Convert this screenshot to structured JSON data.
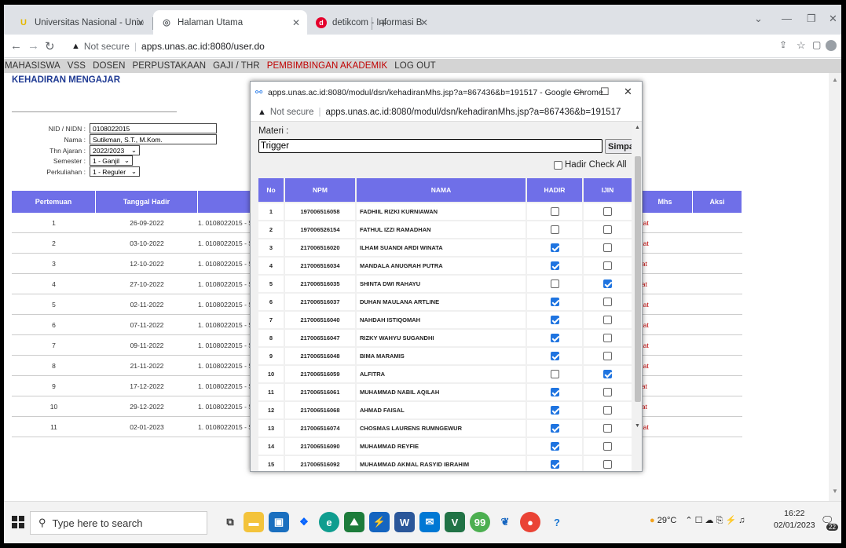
{
  "tabs": [
    {
      "label": "Universitas Nasional - Universitas",
      "icon": "U"
    },
    {
      "label": "Halaman Utama",
      "icon": "globe"
    },
    {
      "label": "detikcom - Informasi Berita Terkini",
      "icon": "d"
    }
  ],
  "address": {
    "security": "Not secure",
    "url": "apps.unas.ac.id:8080/user.do"
  },
  "menu": [
    "MAHASISWA",
    "VSS",
    "DOSEN",
    "PERPUSTAKAAN",
    "GAJI / THR",
    "PEMBIMBINGAN AKADEMIK",
    "LOG OUT"
  ],
  "page": {
    "title": "KEHADIRAN MENGAJAR",
    "form": {
      "nid_label": "NID / NIDN :",
      "nid": "0108022015",
      "nama_label": "Nama :",
      "nama": "Sutikman, S.T., M.Kom.",
      "thn_label": "Thn Ajaran :",
      "thn": "2022/2023",
      "sem_label": "Semester :",
      "sem": "1 - Ganjil",
      "kul_label": "Perkuliahan :",
      "kul": "1 - Reguler"
    },
    "table_headers": [
      "Pertemuan",
      "Tanggal Hadir",
      "",
      "Mhs",
      "Aksi"
    ],
    "rows": [
      {
        "no": "1",
        "tgl": "26-09-2022",
        "dosen": "1. 0108022015 - S",
        "aksi": "ihat"
      },
      {
        "no": "2",
        "tgl": "03-10-2022",
        "dosen": "1. 0108022015 - S",
        "aksi": "ihat"
      },
      {
        "no": "3",
        "tgl": "12-10-2022",
        "dosen": "1. 0108022015 - S",
        "aksi": "hat"
      },
      {
        "no": "4",
        "tgl": "27-10-2022",
        "dosen": "1. 0108022015 - S",
        "aksi": "hat"
      },
      {
        "no": "5",
        "tgl": "02-11-2022",
        "dosen": "1. 0108022015 - S",
        "aksi": "ihat"
      },
      {
        "no": "6",
        "tgl": "07-11-2022",
        "dosen": "1. 0108022015 - S",
        "aksi": "ihat"
      },
      {
        "no": "7",
        "tgl": "09-11-2022",
        "dosen": "1. 0108022015 - S",
        "aksi": "ihat"
      },
      {
        "no": "8",
        "tgl": "21-11-2022",
        "dosen": "1. 0108022015 - S",
        "aksi": "ihat"
      },
      {
        "no": "9",
        "tgl": "17-12-2022",
        "dosen": "1. 0108022015 - S",
        "aksi": "hat"
      },
      {
        "no": "10",
        "tgl": "29-12-2022",
        "dosen": "1. 0108022015 - S",
        "aksi": "hat"
      },
      {
        "no": "11",
        "tgl": "02-01-2023",
        "dosen": "1. 0108022015 - S",
        "aksi": "ihat"
      }
    ]
  },
  "popup": {
    "title": "apps.unas.ac.id:8080/modul/dsn/kehadiranMhs.jsp?a=867436&b=191517 - Google Chrome",
    "security": "Not secure",
    "url": "apps.unas.ac.id:8080/modul/dsn/kehadiranMhs.jsp?a=867436&b=191517",
    "materi_label": "Materi :",
    "materi_value": "Trigger",
    "simpan": "Simpan",
    "hadir_all": "Hadir Check All",
    "headers": [
      "No",
      "NPM",
      "NAMA",
      "HADIR",
      "IJIN"
    ],
    "rows": [
      {
        "no": "1",
        "npm": "197006516058",
        "nama": "FADHIIL RIZKI KURNIAWAN",
        "hadir": false,
        "ijin": false
      },
      {
        "no": "2",
        "npm": "197006526154",
        "nama": "FATHUL IZZI RAMADHAN",
        "hadir": false,
        "ijin": false
      },
      {
        "no": "3",
        "npm": "217006516020",
        "nama": "ILHAM SUANDI ARDI WINATA",
        "hadir": true,
        "ijin": false
      },
      {
        "no": "4",
        "npm": "217006516034",
        "nama": "MANDALA ANUGRAH PUTRA",
        "hadir": true,
        "ijin": false
      },
      {
        "no": "5",
        "npm": "217006516035",
        "nama": "SHINTA DWI RAHAYU",
        "hadir": false,
        "ijin": true
      },
      {
        "no": "6",
        "npm": "217006516037",
        "nama": "DUHAN MAULANA ARTLINE",
        "hadir": true,
        "ijin": false
      },
      {
        "no": "7",
        "npm": "217006516040",
        "nama": "NAHDAH ISTIQOMAH",
        "hadir": true,
        "ijin": false
      },
      {
        "no": "8",
        "npm": "217006516047",
        "nama": "RIZKY WAHYU SUGANDHI",
        "hadir": true,
        "ijin": false
      },
      {
        "no": "9",
        "npm": "217006516048",
        "nama": "BIMA MARAMIS",
        "hadir": true,
        "ijin": false
      },
      {
        "no": "10",
        "npm": "217006516059",
        "nama": "ALFITRA",
        "hadir": false,
        "ijin": true
      },
      {
        "no": "11",
        "npm": "217006516061",
        "nama": "MUHAMMAD NABIL AQILAH",
        "hadir": true,
        "ijin": false
      },
      {
        "no": "12",
        "npm": "217006516068",
        "nama": "AHMAD FAISAL",
        "hadir": true,
        "ijin": false
      },
      {
        "no": "13",
        "npm": "217006516074",
        "nama": "CHOSMAS LAURENS RUMNGEWUR",
        "hadir": true,
        "ijin": false
      },
      {
        "no": "14",
        "npm": "217006516090",
        "nama": "MUHAMMAD REYFIE",
        "hadir": true,
        "ijin": false
      },
      {
        "no": "15",
        "npm": "217006516092",
        "nama": "MUHAMMAD AKMAL RASYID IBRAHIM",
        "hadir": true,
        "ijin": false
      }
    ]
  },
  "taskbar": {
    "search_placeholder": "Type here to search",
    "weather": "29°C",
    "time": "16:22",
    "date": "02/01/2023",
    "notif": "22"
  }
}
